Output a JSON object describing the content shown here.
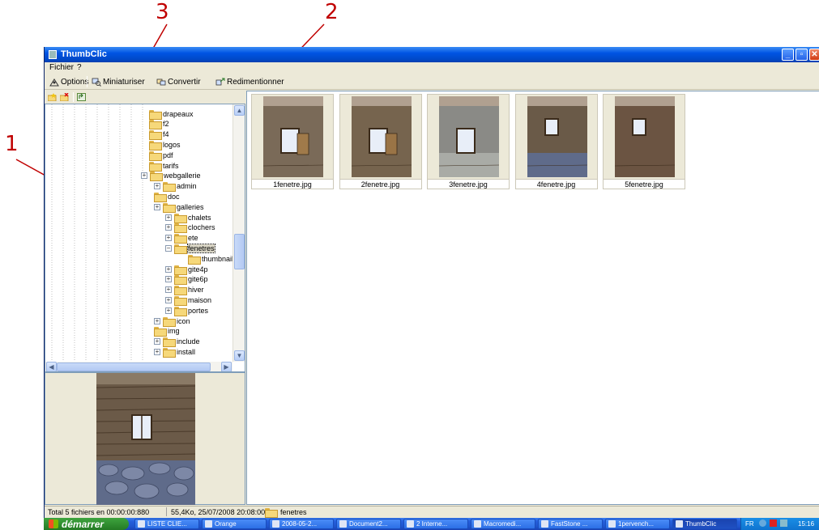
{
  "annotations": {
    "one": "1",
    "two": "2",
    "three": "3"
  },
  "window": {
    "title": "ThumbClic"
  },
  "menu": {
    "file": "Fichier",
    "help": "?"
  },
  "toolbar": {
    "options": "Options",
    "thumbnails": "Miniaturiser",
    "convert": "Convertir",
    "resize": "Redimentionner"
  },
  "tree": {
    "nodes": [
      {
        "label": "drapeaux"
      },
      {
        "label": "f2"
      },
      {
        "label": "f4"
      },
      {
        "label": "logos"
      },
      {
        "label": "pdf"
      },
      {
        "label": "tarifs"
      },
      {
        "label": "webgallerie"
      },
      {
        "label": "admin"
      },
      {
        "label": "doc"
      },
      {
        "label": "galleries"
      },
      {
        "label": "chalets"
      },
      {
        "label": "clochers"
      },
      {
        "label": "ete"
      },
      {
        "label": "fenetres"
      },
      {
        "label": "thumbnails"
      },
      {
        "label": "gite4p"
      },
      {
        "label": "gite6p"
      },
      {
        "label": "hiver"
      },
      {
        "label": "maison"
      },
      {
        "label": "portes"
      },
      {
        "label": "icon"
      },
      {
        "label": "img"
      },
      {
        "label": "include"
      },
      {
        "label": "install"
      }
    ]
  },
  "thumbnails": [
    {
      "filename": "1fenetre.jpg"
    },
    {
      "filename": "2fenetre.jpg"
    },
    {
      "filename": "3fenetre.jpg"
    },
    {
      "filename": "4fenetre.jpg"
    },
    {
      "filename": "5fenetre.jpg"
    }
  ],
  "status": {
    "summary": "Total 5 fichiers en 00:00:00:880",
    "fileinfo": "55,4Ko, 25/07/2008 20:08:00",
    "folder": "fenetres"
  },
  "taskbar": {
    "start": "démarrer",
    "tasks": [
      {
        "label": "LISTE CLIE..."
      },
      {
        "label": "Orange"
      },
      {
        "label": "2008-05-2..."
      },
      {
        "label": "Document2..."
      },
      {
        "label": "2 Interne..."
      },
      {
        "label": "Macromedi..."
      },
      {
        "label": "FastStone ..."
      },
      {
        "label": "1pervench..."
      },
      {
        "label": "ThumbClic"
      }
    ],
    "lang": "FR",
    "clock": "15:16"
  },
  "colors": {
    "annotation": "#c00000",
    "titlebar": "#0054e3",
    "taskbar": "#245edb"
  }
}
